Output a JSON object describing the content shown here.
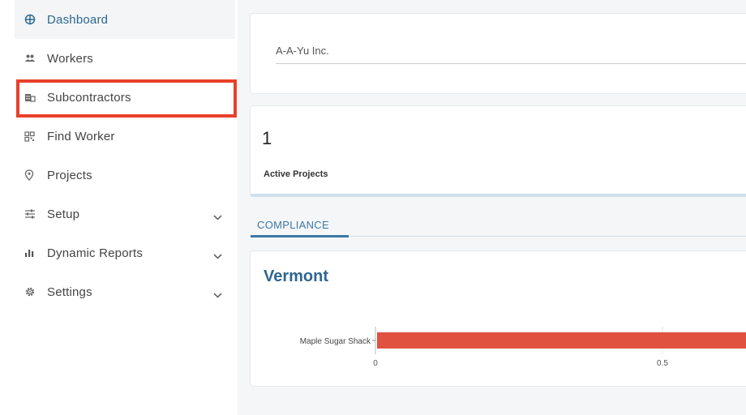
{
  "sidebar": {
    "items": [
      {
        "label": "Dashboard",
        "icon": "dashboard-icon",
        "active": true
      },
      {
        "label": "Workers",
        "icon": "workers-icon"
      },
      {
        "label": "Subcontractors",
        "icon": "building-icon"
      },
      {
        "label": "Find Worker",
        "icon": "qr-code-icon"
      },
      {
        "label": "Projects",
        "icon": "location-pin-icon"
      },
      {
        "label": "Setup",
        "icon": "sliders-icon",
        "expandable": true
      },
      {
        "label": "Dynamic Reports",
        "icon": "bar-chart-icon",
        "expandable": true
      },
      {
        "label": "Settings",
        "icon": "gear-icon",
        "expandable": true
      }
    ]
  },
  "company": {
    "value": "A-A-Yu Inc."
  },
  "stats": {
    "active_projects_count": "1",
    "active_projects_label": "Active Projects"
  },
  "tabs": {
    "compliance": "COMPLIANCE"
  },
  "compliance_chart": {
    "title": "Vermont"
  },
  "chart_data": {
    "type": "bar",
    "orientation": "horizontal",
    "categories": [
      "Maple Sugar Shack"
    ],
    "values": [
      1
    ],
    "xticks": [
      "0",
      "0.5"
    ],
    "xlim": [
      0,
      1
    ],
    "color": "#e05140"
  },
  "colors": {
    "accent": "#2f6690",
    "highlight": "#e8402a",
    "bar": "#e05140"
  }
}
